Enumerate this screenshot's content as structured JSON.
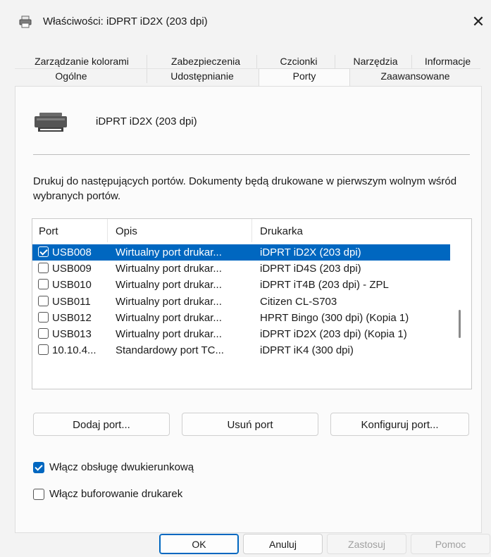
{
  "window": {
    "title": "Właściwości: iDPRT iD2X (203 dpi)"
  },
  "tabs": {
    "row1": [
      "Zarządzanie kolorami",
      "Zabezpieczenia",
      "Czcionki",
      "Narzędzia",
      "Informacje"
    ],
    "row2": [
      "Ogólne",
      "Udostępnianie",
      "Porty",
      "Zaawansowane"
    ],
    "active": "Porty"
  },
  "printer": {
    "name": "iDPRT iD2X (203 dpi)",
    "icon": "printer-icon"
  },
  "description": "Drukuj do następujących portów. Dokumenty będą drukowane w pierwszym wolnym wśród wybranych portów.",
  "ports": {
    "columns": [
      "Port",
      "Opis",
      "Drukarka"
    ],
    "rows": [
      {
        "port": "USB008",
        "desc": "Wirtualny port drukar...",
        "printer": "iDPRT iD2X (203 dpi)",
        "checked": true,
        "selected": true
      },
      {
        "port": "USB009",
        "desc": "Wirtualny port drukar...",
        "printer": "iDPRT iD4S (203 dpi)",
        "checked": false,
        "selected": false
      },
      {
        "port": "USB010",
        "desc": "Wirtualny port drukar...",
        "printer": "iDPRT iT4B (203 dpi) - ZPL",
        "checked": false,
        "selected": false
      },
      {
        "port": "USB011",
        "desc": "Wirtualny port drukar...",
        "printer": "Citizen CL-S703",
        "checked": false,
        "selected": false
      },
      {
        "port": "USB012",
        "desc": "Wirtualny port drukar...",
        "printer": "HPRT Bingo (300 dpi) (Kopia 1)",
        "checked": false,
        "selected": false
      },
      {
        "port": "USB013",
        "desc": "Wirtualny port drukar...",
        "printer": "iDPRT iD2X (203 dpi) (Kopia 1)",
        "checked": false,
        "selected": false
      },
      {
        "port": "10.10.4...",
        "desc": "Standardowy port TC...",
        "printer": "iDPRT iK4 (300 dpi)",
        "checked": false,
        "selected": false
      }
    ]
  },
  "buttons": {
    "add": "Dodaj port...",
    "remove": "Usuń port",
    "configure": "Konfiguruj port..."
  },
  "options": {
    "bidirectional": {
      "label": "Włącz obsługę dwukierunkową",
      "checked": true
    },
    "pooling": {
      "label": "Włącz buforowanie drukarek",
      "checked": false
    }
  },
  "dialog": {
    "ok": "OK",
    "cancel": "Anuluj",
    "apply": "Zastosuj",
    "help": "Pomoc"
  },
  "colors": {
    "accent": "#0067c0",
    "selection": "#0067c0"
  }
}
